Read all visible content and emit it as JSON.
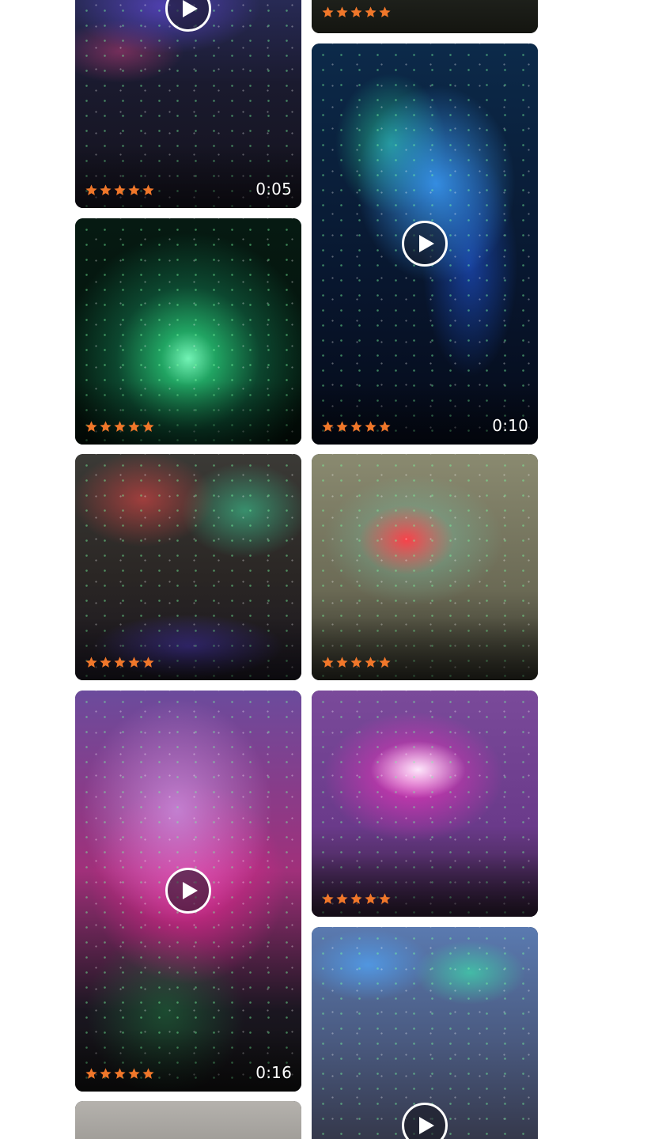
{
  "colors": {
    "star_fill": "#F0772A",
    "background": "#FFFFFF",
    "duration_text": "#FFFFFF"
  },
  "icons": {
    "rating": "star-icon",
    "video": "play-icon"
  },
  "gallery": {
    "items": [
      {
        "rating": 5,
        "is_video": true,
        "duration": "0:05"
      },
      {
        "rating": 5,
        "is_video": false,
        "duration": null
      },
      {
        "rating": 5,
        "is_video": true,
        "duration": "0:10"
      },
      {
        "rating": 5,
        "is_video": false,
        "duration": null
      },
      {
        "rating": 5,
        "is_video": false,
        "duration": null
      },
      {
        "rating": 5,
        "is_video": false,
        "duration": null
      },
      {
        "rating": 5,
        "is_video": true,
        "duration": "0:16"
      },
      {
        "rating": 5,
        "is_video": false,
        "duration": null
      },
      {
        "rating": 5,
        "is_video": true,
        "duration": null
      },
      {
        "rating": 5,
        "is_video": false,
        "duration": null
      }
    ]
  }
}
